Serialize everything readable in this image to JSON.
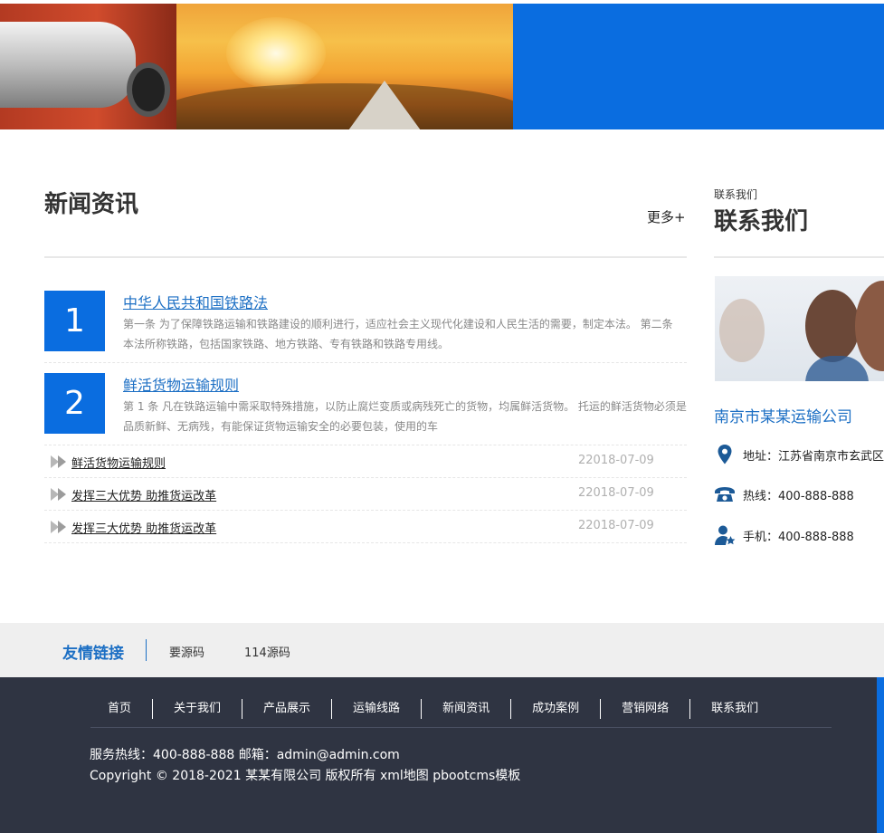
{
  "news": {
    "title": "新闻资讯",
    "more": "更多+",
    "featured": [
      {
        "num": "1",
        "title": "中华人民共和国铁路法",
        "desc": "第一条 为了保障铁路运输和铁路建设的顺利进行，适应社会主义现代化建设和人民生活的需要，制定本法。 第二条 本法所称铁路，包括国家铁路、地方铁路、专有铁路和铁路专用线。"
      },
      {
        "num": "2",
        "title": "鲜活货物运输规则",
        "desc": "第 1 条 凡在铁路运输中需采取特殊措施，以防止腐烂变质或病残死亡的货物，均属鲜活货物。 托运的鲜活货物必须是品质新鲜、无病残，有能保证货物运输安全的必要包装，使用的车"
      }
    ],
    "items": [
      {
        "title": "鲜活货物运输规则",
        "date": "22018-07-09"
      },
      {
        "title": "发挥三大优势 助推货运改革",
        "date": "22018-07-09"
      },
      {
        "title": "发挥三大优势 助推货运改革",
        "date": "22018-07-09"
      }
    ]
  },
  "contact": {
    "subtitle": "联系我们",
    "title": "联系我们",
    "company": "南京市某某运输公司",
    "address": "地址：江苏省南京市玄武区玄武湖",
    "hotline": "热线：400-888-888",
    "mobile": "手机：400-888-888",
    "icon_address": "location-pin-icon",
    "icon_hotline": "telephone-icon",
    "icon_mobile": "user-star-icon"
  },
  "links": {
    "label": "友情链接",
    "items": [
      "要源码",
      "114源码"
    ]
  },
  "footer": {
    "nav": [
      "首页",
      "关于我们",
      "产品展示",
      "运输线路",
      "新闻资讯",
      "成功案例",
      "营销网络",
      "联系我们"
    ],
    "line1": "服务热线：400-888-888 邮箱：admin@admin.com",
    "line2": "Copyright © 2018-2021 某某有限公司 版权所有 xml地图 pbootcms模板"
  },
  "colors": {
    "accent": "#0a6de0",
    "link": "#1c6fc4",
    "footer_bg": "#2f3442",
    "links_bg": "#efefef"
  }
}
